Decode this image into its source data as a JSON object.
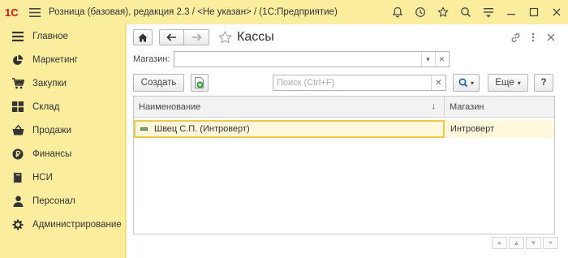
{
  "window": {
    "title": "Розница (базовая), редакция 2.3 / <Не указан> /  (1С:Предприятие)",
    "logo_text": "1С",
    "titlebar_icons": [
      "bell-icon",
      "history-icon",
      "star-icon",
      "search-icon",
      "settings-icon",
      "minimize-icon",
      "maximize-icon",
      "close-icon"
    ]
  },
  "sidebar": {
    "items": [
      {
        "label": "Главное",
        "icon": "menu-lines-icon"
      },
      {
        "label": "Маркетинг",
        "icon": "pie-chart-icon"
      },
      {
        "label": "Закупки",
        "icon": "cart-icon"
      },
      {
        "label": "Склад",
        "icon": "warehouse-icon"
      },
      {
        "label": "Продажи",
        "icon": "basket-icon"
      },
      {
        "label": "Финансы",
        "icon": "ruble-coin-icon"
      },
      {
        "label": "НСИ",
        "icon": "book-icon"
      },
      {
        "label": "Персонал",
        "icon": "person-icon"
      },
      {
        "label": "Администрирование",
        "icon": "gear-icon"
      }
    ]
  },
  "form": {
    "title": "Кассы",
    "filter": {
      "label": "Магазин:",
      "value": ""
    },
    "create_label": "Создать",
    "search_placeholder": "Поиск (Ctrl+F)",
    "more_label": "Еще",
    "help_label": "?"
  },
  "table": {
    "columns": [
      "Наименование",
      "Магазин"
    ],
    "sort_indicator": "↓",
    "rows": [
      {
        "name": "Швец С.П. (Интроверт)",
        "shop": "Интроверт"
      }
    ]
  },
  "colors": {
    "accent_yellow": "#fbed9e",
    "selection_border": "#f0c94b",
    "selection_fill": "#fff8dc"
  }
}
